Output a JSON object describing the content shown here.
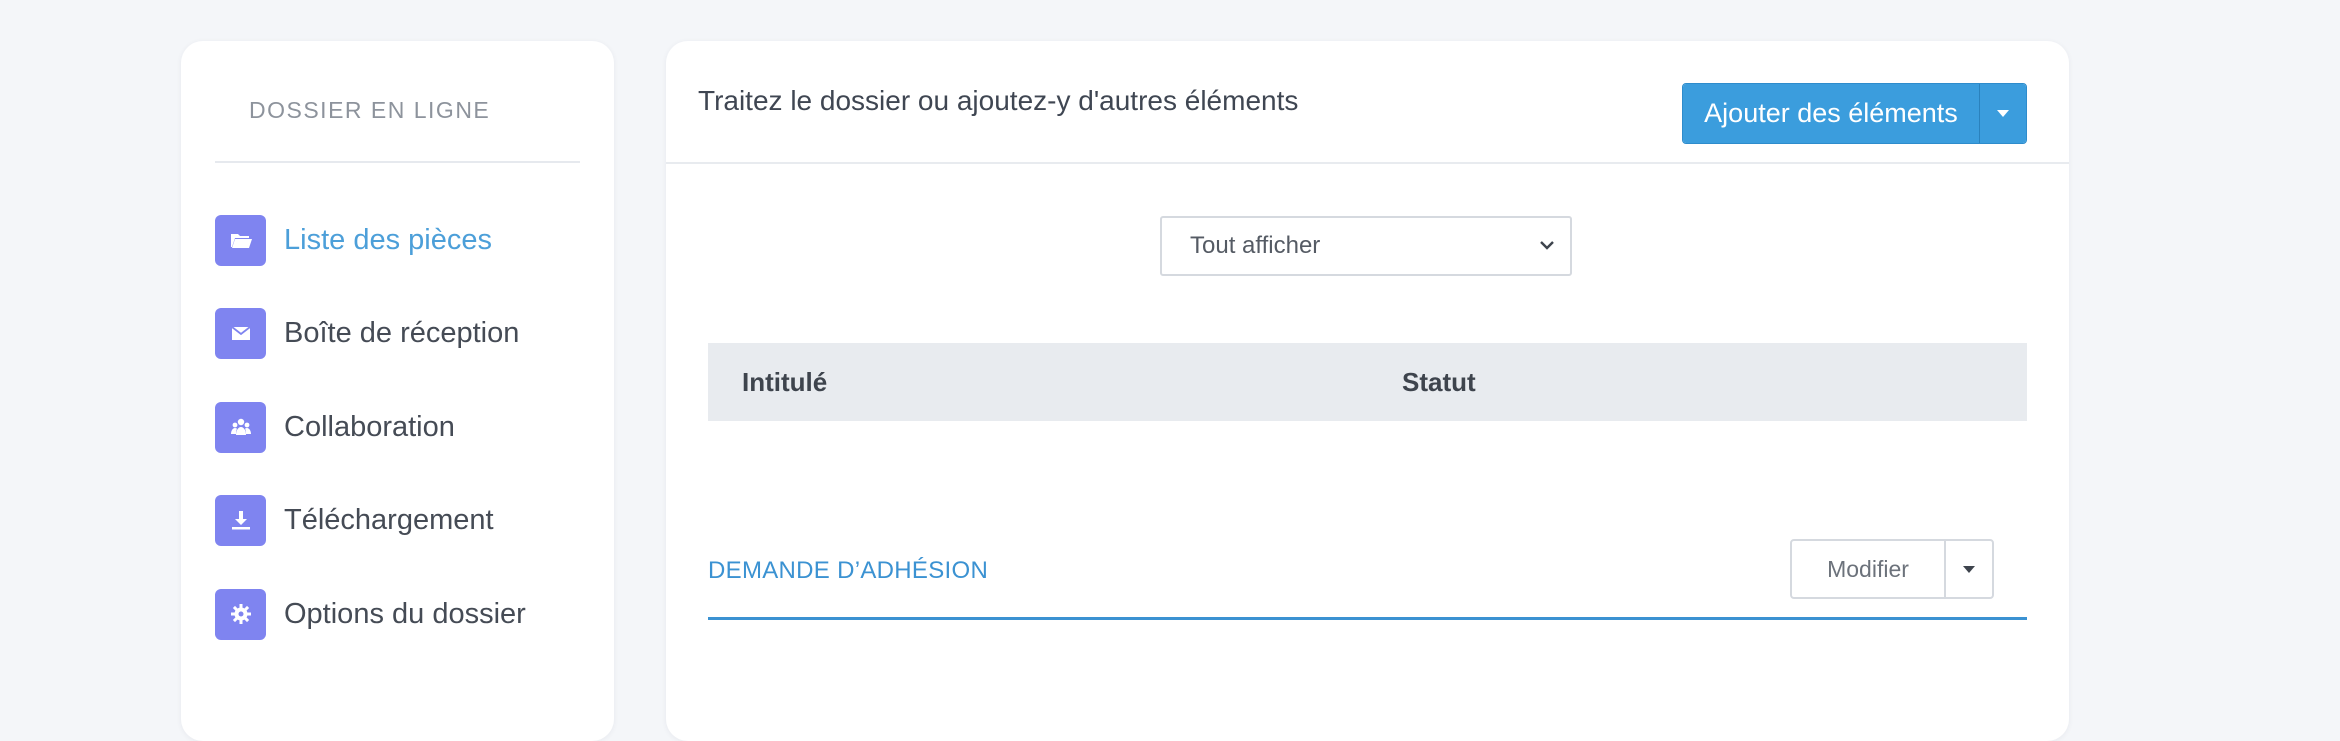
{
  "sidebar": {
    "heading": "DOSSIER EN LIGNE",
    "items": [
      {
        "label": "Liste des pièces",
        "icon": "folder-open-icon",
        "active": true
      },
      {
        "label": "Boîte de réception",
        "icon": "envelope-icon",
        "active": false
      },
      {
        "label": "Collaboration",
        "icon": "users-icon",
        "active": false
      },
      {
        "label": "Téléchargement",
        "icon": "download-icon",
        "active": false
      },
      {
        "label": "Options du dossier",
        "icon": "gear-icon",
        "active": false
      }
    ]
  },
  "main": {
    "title": "Traitez le dossier ou ajoutez-y d'autres éléments",
    "add_button_label": "Ajouter des éléments",
    "filter": {
      "selected": "Tout afficher"
    },
    "table": {
      "columns": [
        "Intitulé",
        "Statut"
      ]
    },
    "section": {
      "title": "DEMANDE D’ADHÉSION",
      "modify_label": "Modifier"
    }
  },
  "colors": {
    "accent": "#3b9ddd",
    "active_link": "#4c9fd9",
    "nav_icon_bg": "#7f84f0",
    "background": "#f4f6f9"
  }
}
